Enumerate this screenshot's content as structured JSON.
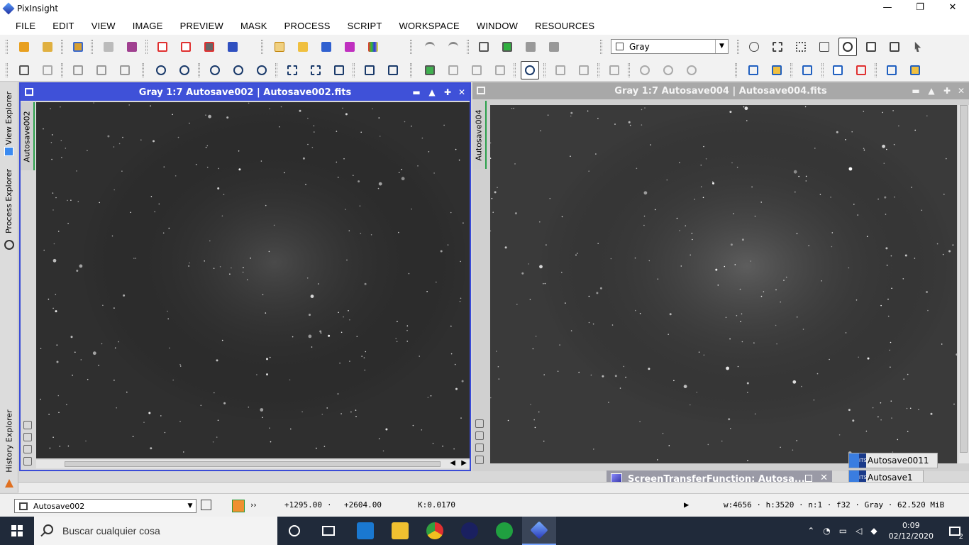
{
  "app": {
    "title": "PixInsight"
  },
  "window_controls": {
    "minimize": "—",
    "maximize": "❐",
    "close": "✕"
  },
  "menu": [
    "FILE",
    "EDIT",
    "VIEW",
    "IMAGE",
    "PREVIEW",
    "MASK",
    "PROCESS",
    "SCRIPT",
    "WORKSPACE",
    "WINDOW",
    "RESOURCES"
  ],
  "toolbar": {
    "colorspace_select": "Gray"
  },
  "left_panel": {
    "view_explorer": "View Explorer",
    "process_explorer": "Process Explorer",
    "history_explorer": "History Explorer"
  },
  "image_windows": [
    {
      "title": "Gray 1:7 Autosave002 | Autosave002.fits",
      "tab": "Autosave002",
      "active": true
    },
    {
      "title": "Gray 1:7 Autosave004 | Autosave004.fits",
      "tab": "Autosave004",
      "active": false
    }
  ],
  "window_buttons": {
    "shade": "▬",
    "maximize": "▲",
    "move": "✚",
    "close": "✕"
  },
  "stacked_tabs": [
    "Autosave0011",
    "Autosave1"
  ],
  "fits_badge": "ITS FITS",
  "stf_window": {
    "title": "ScreenTransferFunction: Autosa..."
  },
  "status": {
    "view": "Autosave002",
    "coords_x": "+1295.00",
    "coords_y": "+2604.00",
    "channel_value": "K:0.0170",
    "image_info": "w:4656 · h:3520 · n:1 · f32 · Gray · 62.520 MiB",
    "more": "››"
  },
  "taskbar": {
    "search_placeholder": "Buscar cualquier cosa",
    "time": "0:09",
    "date": "02/12/2020",
    "notifications": "2"
  },
  "colors": {
    "active_title": "#3f51d8",
    "inactive_title": "#a8a8a8",
    "taskbar": "#202a3a"
  }
}
